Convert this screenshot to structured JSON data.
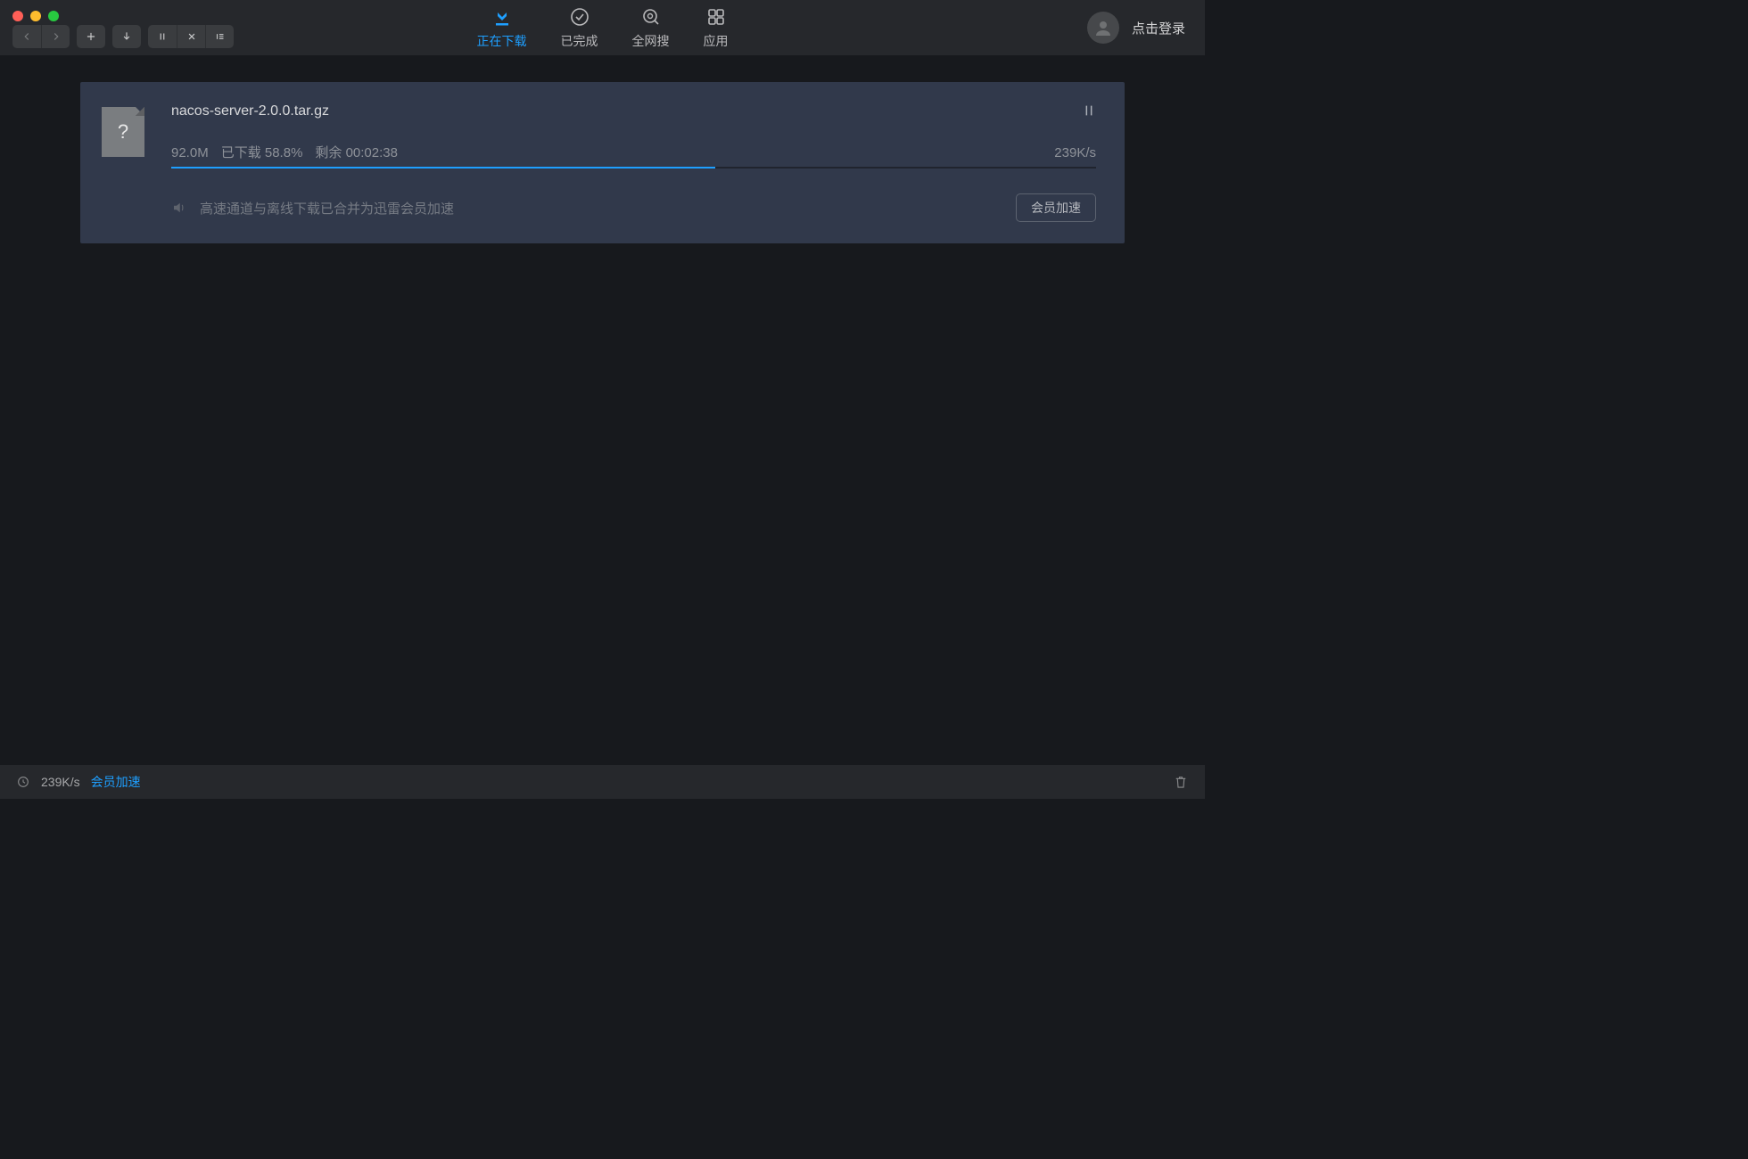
{
  "tabs": {
    "downloading": "正在下载",
    "completed": "已完成",
    "search": "全网搜",
    "apps": "应用"
  },
  "user": {
    "login_label": "点击登录"
  },
  "download": {
    "filename": "nacos-server-2.0.0.tar.gz",
    "size": "92.0M",
    "downloaded_label": "已下载 58.8%",
    "remaining_label": "剩余  00:02:38",
    "speed": "239K/s",
    "progress_percent": 58.8,
    "promo_text": "高速通道与离线下载已合并为迅雷会员加速",
    "member_button": "会员加速",
    "file_icon_glyph": "?"
  },
  "statusbar": {
    "speed": "239K/s",
    "accel_link": "会员加速"
  }
}
